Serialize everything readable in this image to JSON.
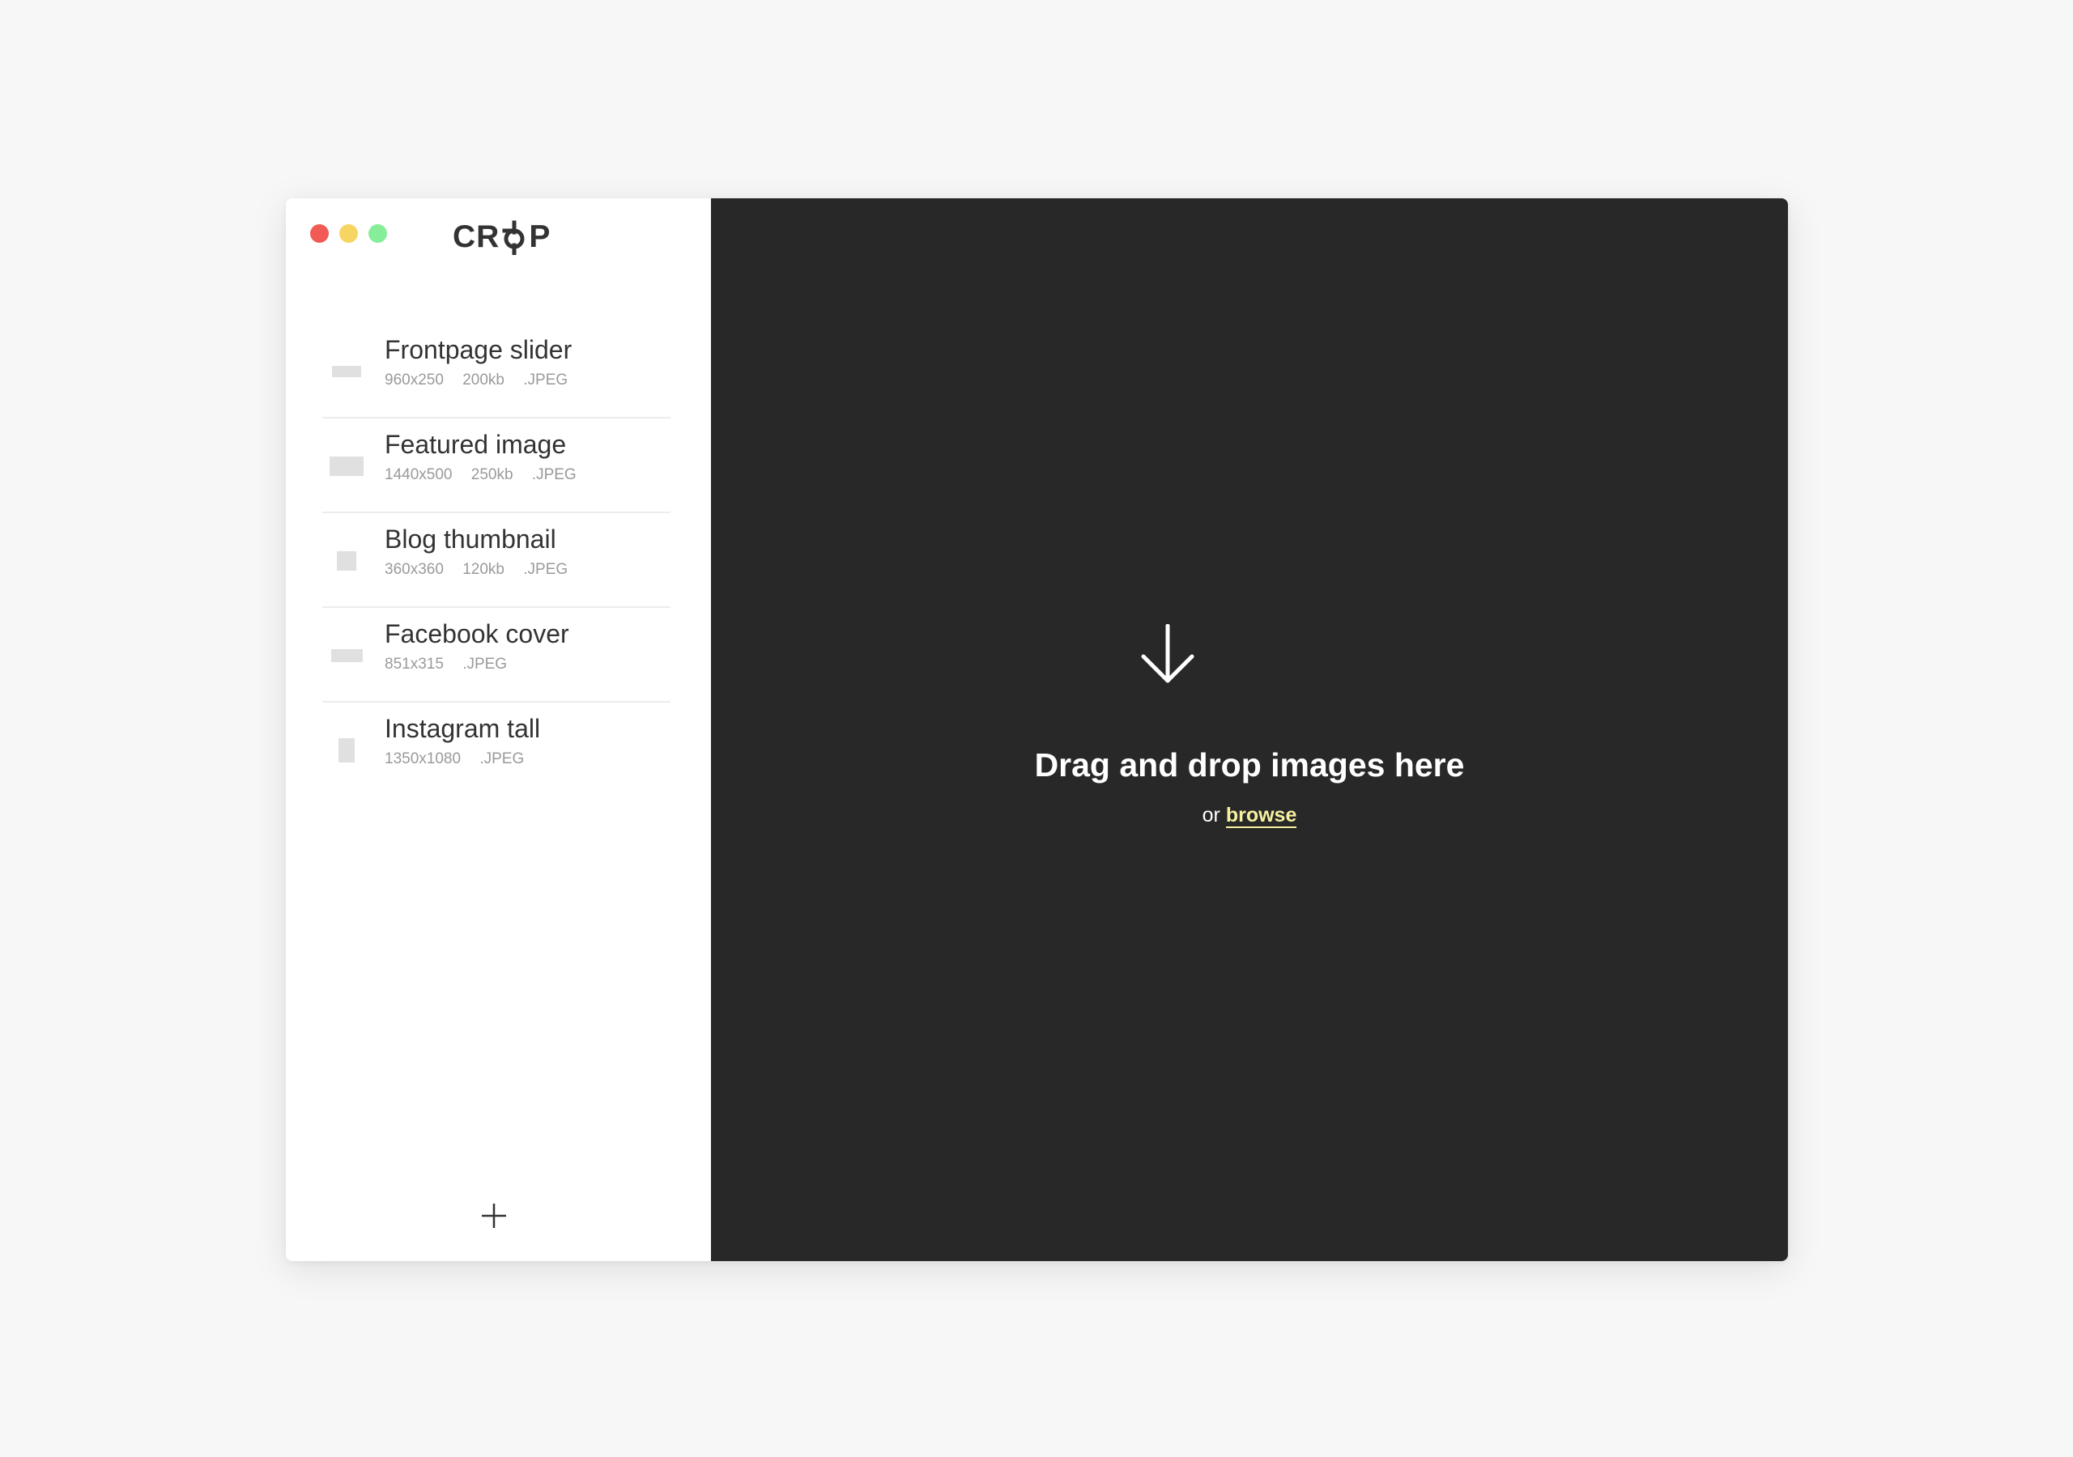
{
  "window": {
    "traffic_lights": {
      "close_color": "#f25a55",
      "minimize_color": "#f7d563",
      "maximize_color": "#86ee99"
    }
  },
  "sidebar": {
    "logo": {
      "prefix": "CR",
      "suffix": "P",
      "mark_icon": "crop-o-icon"
    },
    "presets": [
      {
        "title": "Frontpage slider",
        "dimensions": "960x250",
        "size": "200kb",
        "format": ".JPEG"
      },
      {
        "title": "Featured image",
        "dimensions": "1440x500",
        "size": "250kb",
        "format": ".JPEG"
      },
      {
        "title": "Blog thumbnail",
        "dimensions": "360x360",
        "size": "120kb",
        "format": ".JPEG"
      },
      {
        "title": "Facebook cover",
        "dimensions": "851x315",
        "size": "",
        "format": ".JPEG"
      },
      {
        "title": "Instagram tall",
        "dimensions": "1350x1080",
        "size": "",
        "format": ".JPEG"
      }
    ],
    "add_icon": "plus-icon"
  },
  "dropzone": {
    "icon": "arrow-down-icon",
    "title": "Drag and drop images here",
    "subtitle_prefix": "or",
    "browse_label": "browse",
    "accent_color": "#f6f0a0",
    "background_color": "#282828"
  }
}
